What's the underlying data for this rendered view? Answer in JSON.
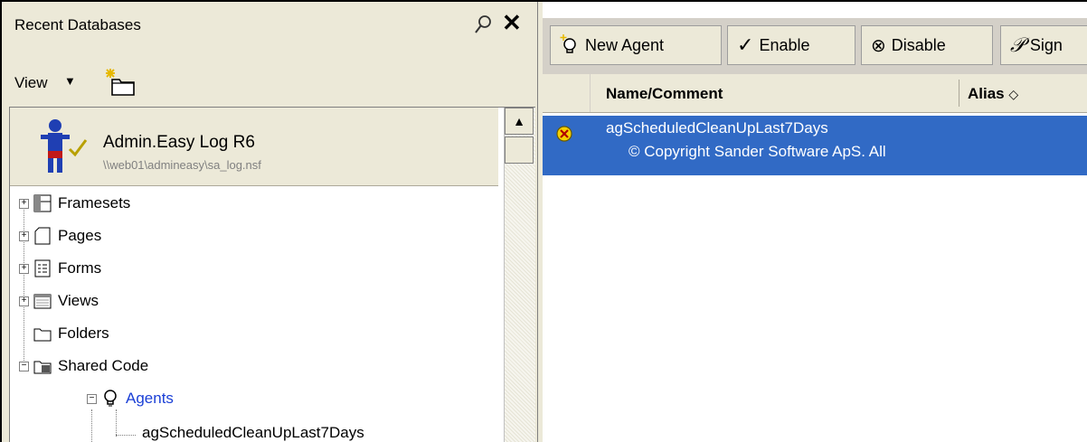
{
  "left_panel": {
    "title": "Recent Databases",
    "view_label": "View",
    "database": {
      "title": "Admin.Easy Log R6",
      "path": "\\\\web01\\admineasy\\sa_log.nsf"
    },
    "tree": [
      {
        "label": "Framesets",
        "icon": "frameset-icon",
        "expandable": true
      },
      {
        "label": "Pages",
        "icon": "page-icon",
        "expandable": true
      },
      {
        "label": "Forms",
        "icon": "form-icon",
        "expandable": true
      },
      {
        "label": "Views",
        "icon": "view-icon",
        "expandable": true
      },
      {
        "label": "Folders",
        "icon": "folder-icon",
        "expandable": false
      },
      {
        "label": "Shared Code",
        "icon": "shared-code-icon",
        "expandable": true,
        "expanded": true
      },
      {
        "label": "Agents",
        "icon": "agent-bulb-icon",
        "expandable": true,
        "expanded": true
      },
      {
        "label": "agScheduledCleanUpLast7Days",
        "icon": "",
        "expandable": false
      }
    ]
  },
  "toolbar": {
    "new_agent": "New Agent",
    "enable": "Enable",
    "disable": "Disable",
    "sign": "Sign"
  },
  "columns": {
    "name": "Name/Comment",
    "alias": "Alias"
  },
  "rows": [
    {
      "name": "agScheduledCleanUpLast7Days",
      "comment": "© Copyright Sander Software ApS. All"
    }
  ],
  "colors": {
    "selection": "#316ac5",
    "panel": "#ece9d8",
    "link": "#1a3fd6"
  }
}
